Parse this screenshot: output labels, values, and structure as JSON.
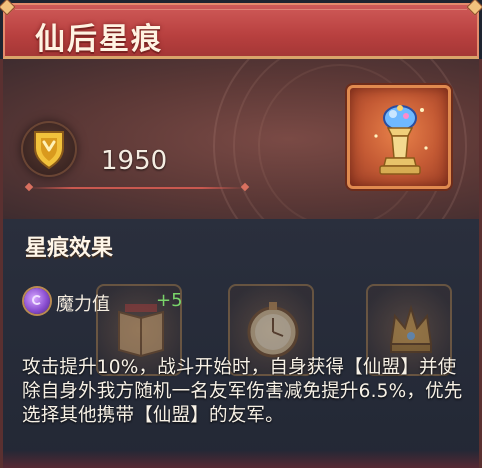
{
  "panel": {
    "title": "仙后星痕",
    "power_value": "1950",
    "power_icon": "shield-icon",
    "item_icon": "chess-queen-icon"
  },
  "effect": {
    "section_title": "星痕效果",
    "stat_icon": "magic-orb-icon",
    "stat_label": "魔力值",
    "stat_bonus": "+5",
    "description": "攻击提升10%，战斗开始时，自身获得【仙盟】并使除自身外我方随机一名友军伤害减免提升6.5%，优先选择其他携带【仙盟】的友军。"
  },
  "slots": [
    {
      "icon": "book-icon"
    },
    {
      "icon": "clock-icon"
    },
    {
      "icon": "crown-icon"
    }
  ],
  "colors": {
    "title_bar": "#b8403f",
    "stat_bonus": "#79d46a",
    "item_frame": "#e08a4f"
  }
}
